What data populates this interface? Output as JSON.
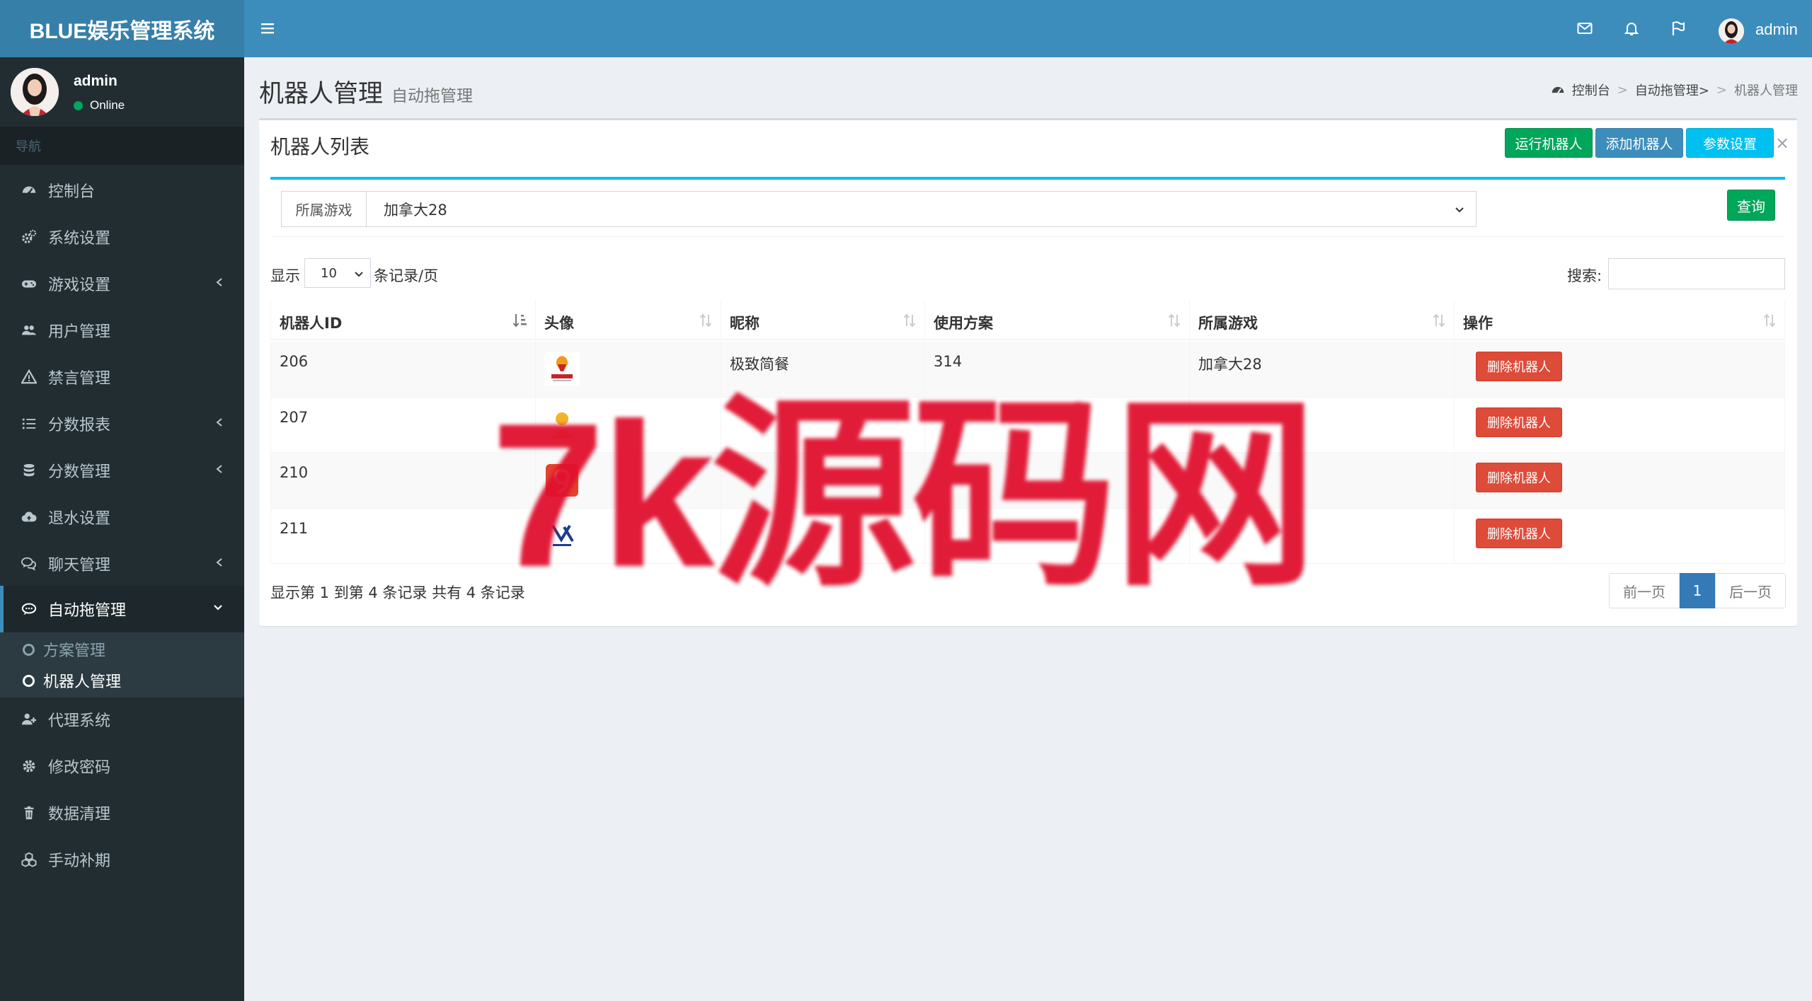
{
  "app": {
    "title": "BLUE娱乐管理系统"
  },
  "user_panel": {
    "name": "admin",
    "status": "Online"
  },
  "sidebar": {
    "header": "导航",
    "items": [
      {
        "label": "控制台",
        "icon": "dashboard-icon"
      },
      {
        "label": "系统设置",
        "icon": "cogs-icon"
      },
      {
        "label": "游戏设置",
        "icon": "gamepad-icon"
      },
      {
        "label": "用户管理",
        "icon": "users-icon"
      },
      {
        "label": "禁言管理",
        "icon": "warning-icon"
      },
      {
        "label": "分数报表",
        "icon": "list-icon"
      },
      {
        "label": "分数管理",
        "icon": "database-icon"
      },
      {
        "label": "退水设置",
        "icon": "cloud-upload-icon"
      },
      {
        "label": "聊天管理",
        "icon": "comments-icon"
      },
      {
        "label": "自动拖管理",
        "icon": "comment-icon"
      },
      {
        "label": "代理系统",
        "icon": "user-plus-icon"
      },
      {
        "label": "修改密码",
        "icon": "gear-icon"
      },
      {
        "label": "数据清理",
        "icon": "trash-icon"
      },
      {
        "label": "手动补期",
        "icon": "cubes-icon"
      }
    ],
    "submenu": [
      {
        "label": "方案管理"
      },
      {
        "label": "机器人管理"
      }
    ]
  },
  "header": {
    "user": "admin"
  },
  "content_header": {
    "title": "机器人管理",
    "subtitle": "自动拖管理",
    "breadcrumb": [
      "控制台",
      "自动拖管理>",
      "机器人管理"
    ]
  },
  "box": {
    "title": "机器人列表",
    "buttons": {
      "run": "运行机器人",
      "add": "添加机器人",
      "params": "参数设置",
      "close": "×"
    },
    "filter": {
      "label": "所属游戏",
      "selected": "加拿大28",
      "query": "查询"
    },
    "length": {
      "prefix": "显示",
      "value": "10",
      "suffix": "条记录/页"
    },
    "search": {
      "label": "搜索:"
    }
  },
  "table": {
    "columns": [
      "机器人ID",
      "头像",
      "昵称",
      "使用方案",
      "所属游戏",
      "操作"
    ],
    "rows": [
      {
        "id": "206",
        "nickname": "极致简餐",
        "plan": "314",
        "game": "加拿大28",
        "action": "删除机器人"
      },
      {
        "id": "207",
        "nickname": "",
        "plan": "",
        "game": "",
        "action": "删除机器人"
      },
      {
        "id": "210",
        "nickname": "",
        "plan": "",
        "game": "",
        "action": "删除机器人"
      },
      {
        "id": "211",
        "nickname": "",
        "plan": "",
        "game": "",
        "action": "删除机器人"
      }
    ],
    "info": "显示第 1 到第 4 条记录 共有 4 条记录"
  },
  "pagination": {
    "prev": "前一页",
    "current": "1",
    "next": "后一页"
  },
  "watermark": "7k源码网",
  "colors": {
    "header": "#3c8dbc",
    "logo": "#367fa9",
    "sidebar": "#222d32",
    "success": "#00a65a",
    "primary": "#3c8dbc",
    "info": "#00c0ef",
    "danger": "#dd4b39",
    "watermark": "#e0102e"
  }
}
